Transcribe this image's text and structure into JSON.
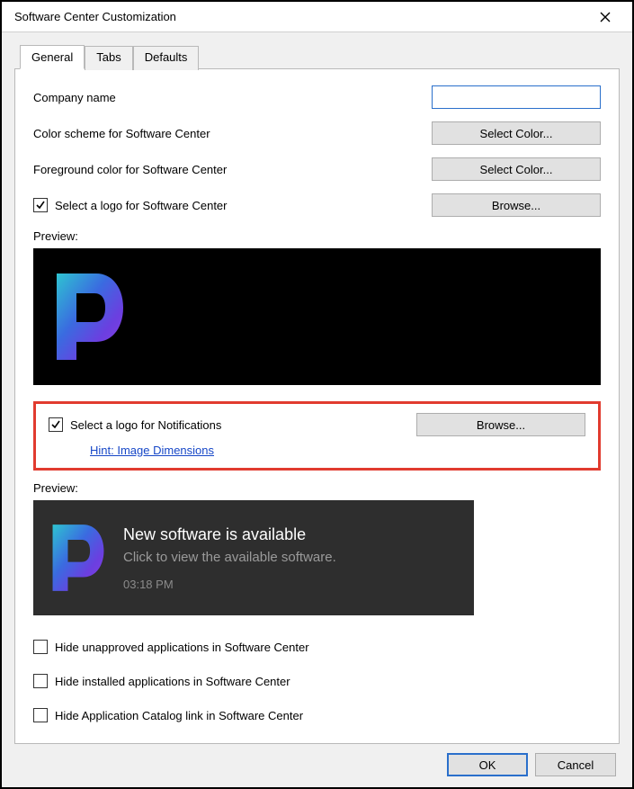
{
  "window": {
    "title": "Software Center Customization"
  },
  "tabs": {
    "items": [
      "General",
      "Tabs",
      "Defaults"
    ],
    "active_index": 0
  },
  "general": {
    "company_name_label": "Company name",
    "company_name_value": "",
    "color_scheme_label": "Color scheme for Software Center",
    "select_color_btn": "Select Color...",
    "fg_color_label": "Foreground color for Software Center",
    "logo_sc_label": "Select a logo for Software Center",
    "logo_sc_checked": true,
    "browse_btn": "Browse...",
    "preview_label": "Preview:",
    "logo_notif_label": "Select a logo for Notifications",
    "logo_notif_checked": true,
    "hint_link": "Hint: Image Dimensions",
    "notif_title": "New software is available",
    "notif_sub": "Click to view the available software.",
    "notif_time": "03:18 PM",
    "hide_unapproved_label": "Hide unapproved applications in Software Center",
    "hide_unapproved_checked": false,
    "hide_installed_label": "Hide installed applications in Software Center",
    "hide_installed_checked": false,
    "hide_appcatalog_label": "Hide Application Catalog link in Software Center",
    "hide_appcatalog_checked": false
  },
  "buttons": {
    "ok": "OK",
    "cancel": "Cancel"
  }
}
